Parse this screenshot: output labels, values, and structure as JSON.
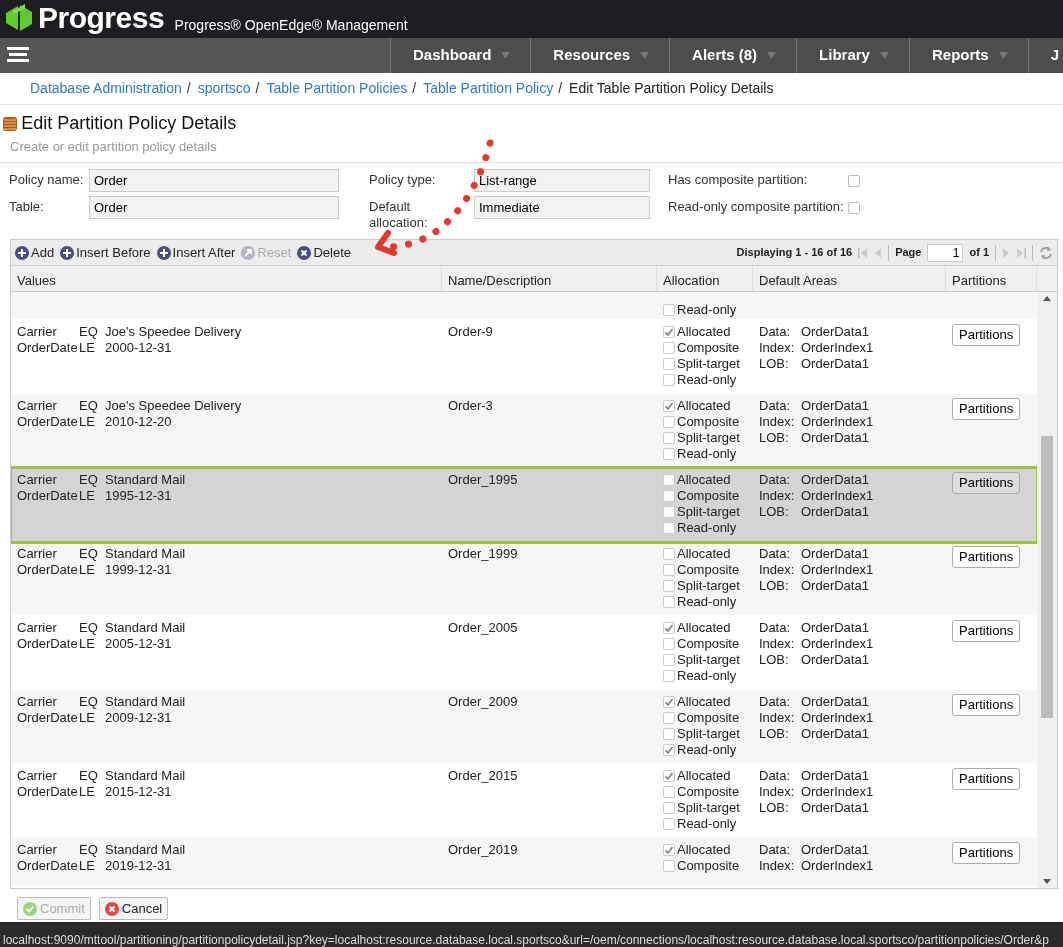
{
  "header": {
    "logo_text": "Progress",
    "product": "Progress® OpenEdge® Management"
  },
  "nav": {
    "items": [
      {
        "label": "Dashboard",
        "caret": true
      },
      {
        "label": "Resources",
        "caret": true
      },
      {
        "label": "Alerts (8)",
        "caret": true
      },
      {
        "label": "Library",
        "caret": true
      },
      {
        "label": "Reports",
        "caret": true
      },
      {
        "label": "J",
        "caret": false
      }
    ]
  },
  "breadcrumbs": [
    {
      "label": "Database Administration",
      "current": false,
      "separator": "/"
    },
    {
      "label": "sportsco",
      "current": false,
      "separator": "/"
    },
    {
      "label": "Table Partition Policies",
      "current": false,
      "separator": "/"
    },
    {
      "label": "Table Partition Policy",
      "current": false,
      "separator": "/"
    },
    {
      "label": "Edit Table Partition Policy Details",
      "current": true
    }
  ],
  "page": {
    "title": "Edit Partition Policy Details",
    "subtitle": "Create or edit partition policy details"
  },
  "form": {
    "fields": [
      {
        "label": "Policy name:",
        "value": "Order"
      },
      {
        "label": "Table:",
        "value": "Order"
      },
      {
        "label": "Policy type:",
        "value": "List-range"
      },
      {
        "label": "Default allocation:",
        "value": "Immediate"
      }
    ],
    "checkboxes": [
      {
        "label": "Has composite partition:",
        "checked": false
      },
      {
        "label": "Read-only composite partition:",
        "checked": false
      }
    ]
  },
  "toolbar": {
    "buttons": [
      {
        "label": "Add",
        "kind": "plus",
        "disabled": false
      },
      {
        "label": "Insert Before",
        "kind": "plus",
        "disabled": false
      },
      {
        "label": "Insert After",
        "kind": "plus",
        "disabled": false
      },
      {
        "label": "Reset",
        "kind": "reset",
        "disabled": true
      },
      {
        "label": "Delete",
        "kind": "delete",
        "disabled": false
      }
    ],
    "pager": {
      "display": "Displaying 1 - 16 of 16",
      "page_label": "Page",
      "page": "1",
      "of": "of 1"
    }
  },
  "table": {
    "columns": [
      "Values",
      "Name/Description",
      "Allocation",
      "Default Areas",
      "Partitions"
    ],
    "rows": [
      {
        "selected": false,
        "values": [],
        "name": "",
        "allocation": [
          {
            "label": "Read-only",
            "checked": false
          }
        ],
        "areas": [],
        "button": ""
      },
      {
        "selected": false,
        "values": [
          {
            "field": "Carrier",
            "op": "EQ",
            "value": "Joe's Speedee Delivery"
          },
          {
            "field": "OrderDate",
            "op": "LE",
            "value": "2000-12-31"
          }
        ],
        "name": "Order-9",
        "allocation": [
          {
            "label": "Allocated",
            "checked": true
          },
          {
            "label": "Composite",
            "checked": false
          },
          {
            "label": "Split-target",
            "checked": false
          },
          {
            "label": "Read-only",
            "checked": false
          }
        ],
        "areas": [
          {
            "label": "Data:",
            "value": "OrderData1"
          },
          {
            "label": "Index:",
            "value": "OrderIndex1"
          },
          {
            "label": "LOB:",
            "value": "OrderData1"
          }
        ],
        "button": "Partitions"
      },
      {
        "selected": false,
        "values": [
          {
            "field": "Carrier",
            "op": "EQ",
            "value": "Joe's Speedee Delivery"
          },
          {
            "field": "OrderDate",
            "op": "LE",
            "value": "2010-12-20"
          }
        ],
        "name": "Order-3",
        "allocation": [
          {
            "label": "Allocated",
            "checked": true
          },
          {
            "label": "Composite",
            "checked": false
          },
          {
            "label": "Split-target",
            "checked": false
          },
          {
            "label": "Read-only",
            "checked": false
          }
        ],
        "areas": [
          {
            "label": "Data:",
            "value": "OrderData1"
          },
          {
            "label": "Index:",
            "value": "OrderIndex1"
          },
          {
            "label": "LOB:",
            "value": "OrderData1"
          }
        ],
        "button": "Partitions"
      },
      {
        "selected": true,
        "values": [
          {
            "field": "Carrier",
            "op": "EQ",
            "value": "Standard Mail"
          },
          {
            "field": "OrderDate",
            "op": "LE",
            "value": "1995-12-31"
          }
        ],
        "name": "Order_1995",
        "allocation": [
          {
            "label": "Allocated",
            "checked": false
          },
          {
            "label": "Composite",
            "checked": false
          },
          {
            "label": "Split-target",
            "checked": false
          },
          {
            "label": "Read-only",
            "checked": false
          }
        ],
        "areas": [
          {
            "label": "Data:",
            "value": "OrderData1"
          },
          {
            "label": "Index:",
            "value": "OrderIndex1"
          },
          {
            "label": "LOB:",
            "value": "OrderData1"
          }
        ],
        "button": "Partitions"
      },
      {
        "selected": false,
        "values": [
          {
            "field": "Carrier",
            "op": "EQ",
            "value": "Standard Mail"
          },
          {
            "field": "OrderDate",
            "op": "LE",
            "value": "1999-12-31"
          }
        ],
        "name": "Order_1999",
        "allocation": [
          {
            "label": "Allocated",
            "checked": false
          },
          {
            "label": "Composite",
            "checked": false
          },
          {
            "label": "Split-target",
            "checked": false
          },
          {
            "label": "Read-only",
            "checked": false
          }
        ],
        "areas": [
          {
            "label": "Data:",
            "value": "OrderData1"
          },
          {
            "label": "Index:",
            "value": "OrderIndex1"
          },
          {
            "label": "LOB:",
            "value": "OrderData1"
          }
        ],
        "button": "Partitions"
      },
      {
        "selected": false,
        "values": [
          {
            "field": "Carrier",
            "op": "EQ",
            "value": "Standard Mail"
          },
          {
            "field": "OrderDate",
            "op": "LE",
            "value": "2005-12-31"
          }
        ],
        "name": "Order_2005",
        "allocation": [
          {
            "label": "Allocated",
            "checked": true
          },
          {
            "label": "Composite",
            "checked": false
          },
          {
            "label": "Split-target",
            "checked": false
          },
          {
            "label": "Read-only",
            "checked": false
          }
        ],
        "areas": [
          {
            "label": "Data:",
            "value": "OrderData1"
          },
          {
            "label": "Index:",
            "value": "OrderIndex1"
          },
          {
            "label": "LOB:",
            "value": "OrderData1"
          }
        ],
        "button": "Partitions"
      },
      {
        "selected": false,
        "values": [
          {
            "field": "Carrier",
            "op": "EQ",
            "value": "Standard Mail"
          },
          {
            "field": "OrderDate",
            "op": "LE",
            "value": "2009-12-31"
          }
        ],
        "name": "Order_2009",
        "allocation": [
          {
            "label": "Allocated",
            "checked": true
          },
          {
            "label": "Composite",
            "checked": false
          },
          {
            "label": "Split-target",
            "checked": false
          },
          {
            "label": "Read-only",
            "checked": true
          }
        ],
        "areas": [
          {
            "label": "Data:",
            "value": "OrderData1"
          },
          {
            "label": "Index:",
            "value": "OrderIndex1"
          },
          {
            "label": "LOB:",
            "value": "OrderData1"
          }
        ],
        "button": "Partitions"
      },
      {
        "selected": false,
        "values": [
          {
            "field": "Carrier",
            "op": "EQ",
            "value": "Standard Mail"
          },
          {
            "field": "OrderDate",
            "op": "LE",
            "value": "2015-12-31"
          }
        ],
        "name": "Order_2015",
        "allocation": [
          {
            "label": "Allocated",
            "checked": true
          },
          {
            "label": "Composite",
            "checked": false
          },
          {
            "label": "Split-target",
            "checked": false
          },
          {
            "label": "Read-only",
            "checked": false
          }
        ],
        "areas": [
          {
            "label": "Data:",
            "value": "OrderData1"
          },
          {
            "label": "Index:",
            "value": "OrderIndex1"
          },
          {
            "label": "LOB:",
            "value": "OrderData1"
          }
        ],
        "button": "Partitions"
      },
      {
        "selected": false,
        "values": [
          {
            "field": "Carrier",
            "op": "EQ",
            "value": "Standard Mail"
          },
          {
            "field": "OrderDate",
            "op": "LE",
            "value": "2019-12-31"
          }
        ],
        "name": "Order_2019",
        "allocation": [
          {
            "label": "Allocated",
            "checked": true
          },
          {
            "label": "Composite",
            "checked": false
          }
        ],
        "areas": [
          {
            "label": "Data:",
            "value": "OrderData1"
          },
          {
            "label": "Index:",
            "value": "OrderIndex1"
          }
        ],
        "button": "Partitions"
      }
    ]
  },
  "footer": {
    "buttons": [
      {
        "label": "Commit",
        "kind": "commit",
        "disabled": true
      },
      {
        "label": "Cancel",
        "kind": "cancel",
        "disabled": false
      }
    ]
  },
  "status_bar": {
    "url": "localhost:9090/mttool/partitioning/partitionpolicydetail.jsp?key=localhost:resource.database.local.sportsco&url=/oem/connections/localhost:resource.database.local.sportsco/partitionpolicies/Order&p"
  }
}
